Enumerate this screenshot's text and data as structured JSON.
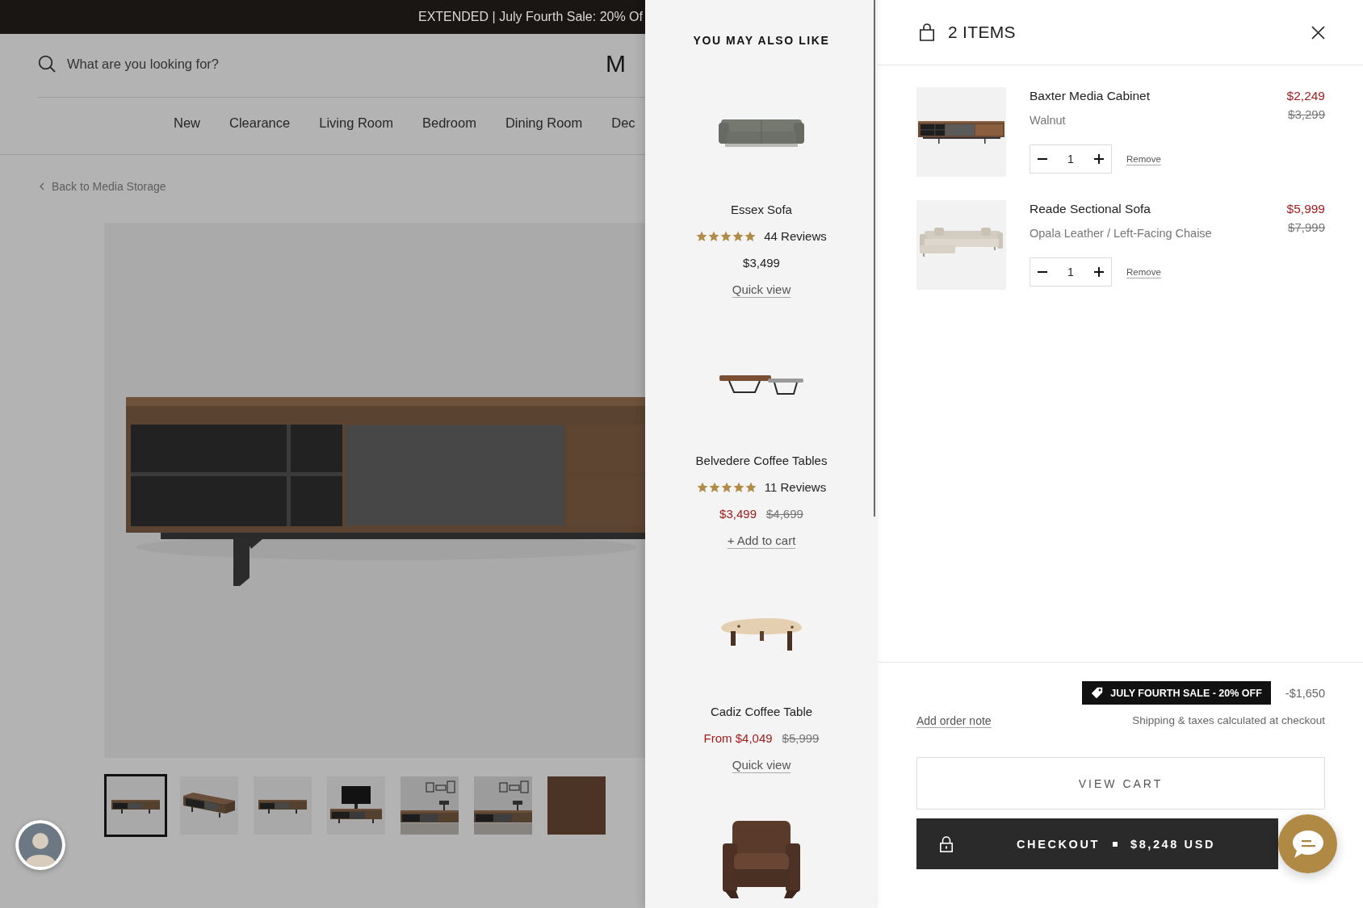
{
  "announcement": {
    "text": "EXTENDED | July Fourth Sale: 20% Of"
  },
  "header": {
    "search": {
      "placeholder": "What are you looking for?"
    },
    "logo": "M",
    "nav": [
      {
        "label": "New"
      },
      {
        "label": "Clearance"
      },
      {
        "label": "Living Room"
      },
      {
        "label": "Bedroom"
      },
      {
        "label": "Dining Room"
      },
      {
        "label": "Dec"
      }
    ]
  },
  "back_link": "Back to Media Storage",
  "gallery": {
    "thumbnails": [
      {
        "kind": "front",
        "selected": true
      },
      {
        "kind": "angled",
        "selected": false
      },
      {
        "kind": "front",
        "selected": false
      },
      {
        "kind": "tv",
        "selected": false
      },
      {
        "kind": "room",
        "selected": false
      },
      {
        "kind": "room",
        "selected": false
      },
      {
        "kind": "swatch",
        "selected": false
      }
    ]
  },
  "recommendations": {
    "title": "YOU MAY ALSO LIKE",
    "products": [
      {
        "name": "Essex Sofa",
        "stars": 5,
        "reviews": "44 Reviews",
        "price": "$3,499",
        "sale": false,
        "action": "Quick view"
      },
      {
        "name": "Belvedere Coffee Tables",
        "stars": 5,
        "reviews": "11 Reviews",
        "price": "$3,499",
        "compare_price": "$4,699",
        "sale": true,
        "action": "+ Add to cart"
      },
      {
        "name": "Cadiz Coffee Table",
        "price": "From $4,049",
        "compare_price": "$5,999",
        "sale": true,
        "action": "Quick view"
      }
    ]
  },
  "cart": {
    "title": "2 ITEMS",
    "items": [
      {
        "name": "Baxter Media Cabinet",
        "variant": "Walnut",
        "quantity": "1",
        "remove": "Remove",
        "price": "$2,249",
        "compare_price": "$3,299"
      },
      {
        "name": "Reade Sectional Sofa",
        "variant": "Opala Leather / Left-Facing Chaise",
        "quantity": "1",
        "remove": "Remove",
        "price": "$5,999",
        "compare_price": "$7,999"
      }
    ],
    "discount": {
      "label": "JULY FOURTH SALE - 20% OFF",
      "amount": "-$1,650"
    },
    "order_note": "Add order note",
    "shipping_note": "Shipping & taxes calculated at checkout",
    "view_cart": "VIEW CART",
    "checkout": {
      "label": "CHECKOUT",
      "total": "$8,248 USD"
    }
  }
}
